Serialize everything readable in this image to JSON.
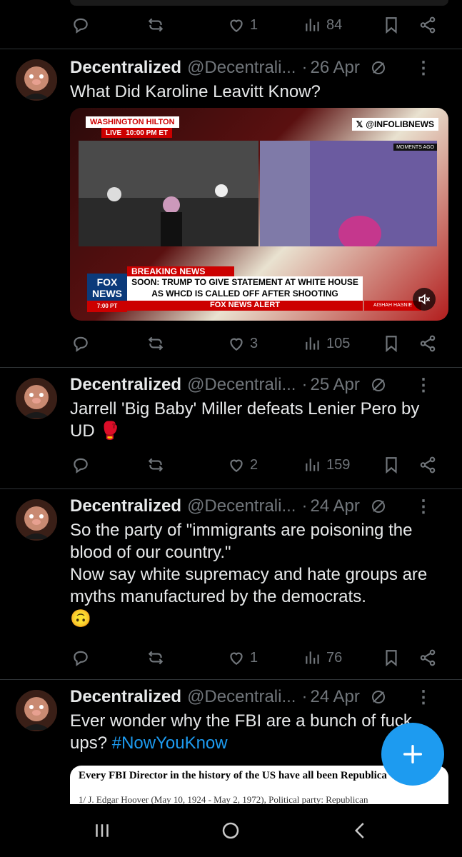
{
  "top_actions": {
    "reply": "",
    "repost": "",
    "likes": "1",
    "views": "84"
  },
  "tweets": [
    {
      "name": "Decentralized",
      "handle": "@Decentrali...",
      "date": "26 Apr",
      "text": "What Did Karoline Leavitt Know?",
      "likes": "3",
      "views": "105",
      "media": {
        "live_location": "WASHINGTON HILTON",
        "live_label": "LIVE",
        "live_time": "10:00 PM ET",
        "watermark": "@INFOLIBNEWS",
        "moments_ago": "MOMENTS AGO",
        "breaking": "BREAKING NEWS",
        "headline_1": "SOON: TRUMP TO GIVE STATEMENT AT WHITE HOUSE",
        "headline_2": "AS WHCD IS CALLED OFF AFTER SHOOTING",
        "alert": "FOX NEWS ALERT",
        "logo_line1": "FOX",
        "logo_line2": "NEWS",
        "logo_time": "7:00 PT",
        "anchor": "AISHAH HASNIE"
      }
    },
    {
      "name": "Decentralized",
      "handle": "@Decentrali...",
      "date": "25 Apr",
      "text": "Jarrell 'Big Baby' Miller defeats Lenier Pero by UD 🥊",
      "likes": "2",
      "views": "159"
    },
    {
      "name": "Decentralized",
      "handle": "@Decentrali...",
      "date": "24 Apr",
      "text": "So the party of \"immigrants are poisoning the blood of our country.\"\nNow say white supremacy and hate groups are myths manufactured by the democrats.\n🙃",
      "likes": "1",
      "views": "76"
    },
    {
      "name": "Decentralized",
      "handle": "@Decentrali...",
      "date": "24 Apr",
      "text_pre": "Ever wonder why the FBI are a bunch of fuck ups? ",
      "hashtag": "#NowYouKnow",
      "media": {
        "doc_title": "Every FBI Director in the history of the US have all been Republica",
        "doc_line": "1/ J. Edgar Hoover (May 10, 1924 - May 2, 1972), Political party: Republican"
      }
    }
  ],
  "colors": {
    "accent": "#1d9bf0",
    "muted": "#71767b",
    "border": "#2f3336"
  },
  "icons": [
    "reply-icon",
    "repost-icon",
    "like-icon",
    "views-icon",
    "bookmark-icon",
    "share-icon",
    "more-icon",
    "hidden-reply-icon",
    "compose-plus-icon",
    "nav-recents-icon",
    "nav-home-icon",
    "nav-back-icon"
  ]
}
